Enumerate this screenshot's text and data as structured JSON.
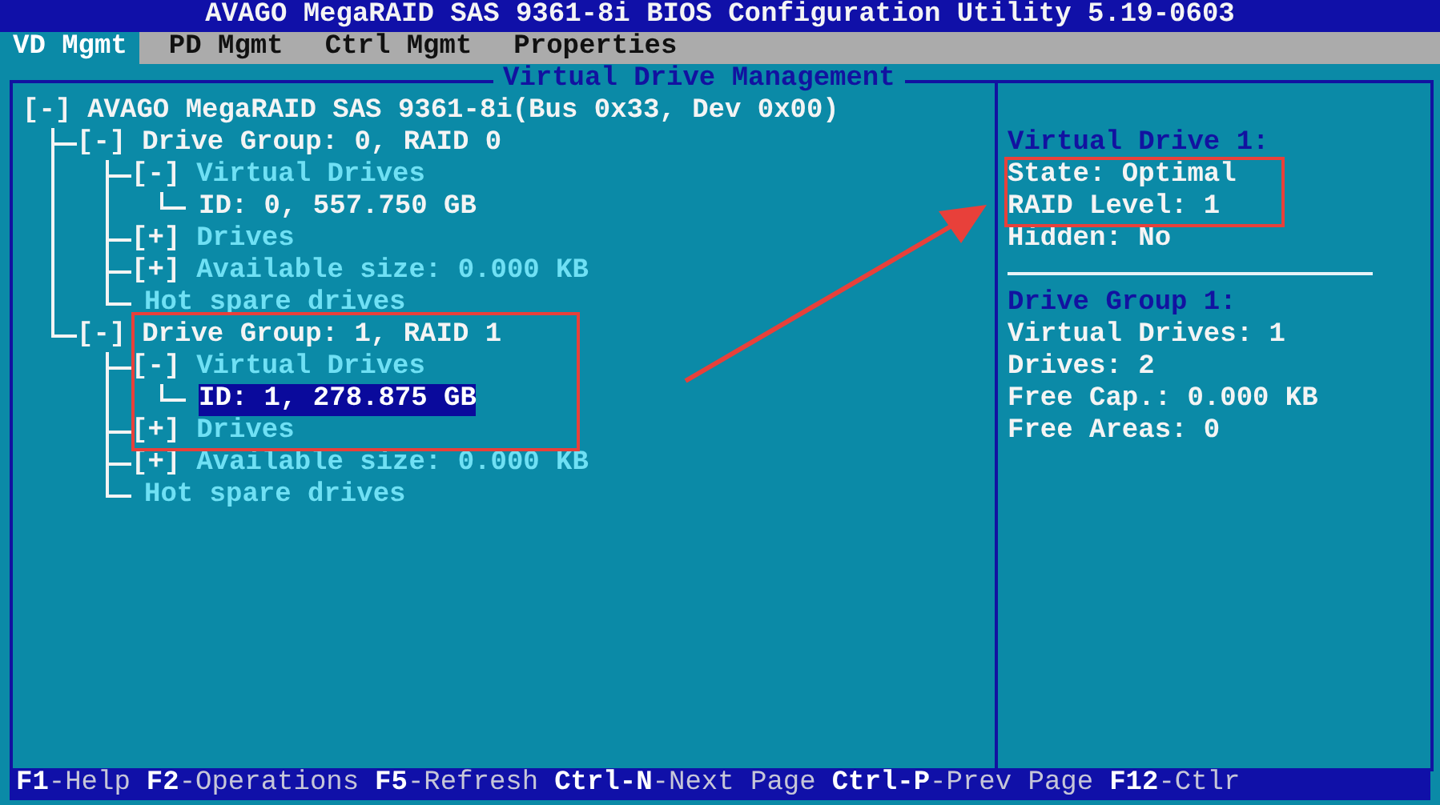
{
  "title_bar": {
    "title": "AVAGO MegaRAID SAS 9361-8i BIOS Configuration Utility 5.19-0603"
  },
  "tabs": [
    {
      "label": "VD Mgmt",
      "selected": true
    },
    {
      "label": "PD Mgmt",
      "selected": false
    },
    {
      "label": "Ctrl Mgmt",
      "selected": false
    },
    {
      "label": "Properties",
      "selected": false
    }
  ],
  "tree_panel": {
    "title": "Virtual Drive Management",
    "tree": [
      {
        "toggle": "[-]",
        "label": "AVAGO MegaRAID SAS 9361-8i(Bus 0x33, Dev 0x00)",
        "kind": "node",
        "selected": false,
        "children": [
          {
            "toggle": "[-]",
            "label": "Drive Group: 0, RAID 0",
            "kind": "node",
            "selected": false,
            "children": [
              {
                "toggle": "[-]",
                "label": "Virtual Drives",
                "kind": "category",
                "selected": false,
                "children": [
                  {
                    "label": "ID: 0, 557.750 GB",
                    "kind": "node",
                    "selected": false
                  }
                ]
              },
              {
                "toggle": "[+]",
                "label": "Drives",
                "kind": "category",
                "selected": false
              },
              {
                "toggle": "[+]",
                "label": "Available size: 0.000 KB",
                "kind": "category",
                "selected": false
              },
              {
                "label": "Hot spare drives",
                "kind": "category",
                "selected": false
              }
            ]
          },
          {
            "toggle": "[-]",
            "label": "Drive Group: 1, RAID 1",
            "kind": "node",
            "selected": false,
            "children": [
              {
                "toggle": "[-]",
                "label": "Virtual Drives",
                "kind": "category",
                "selected": false,
                "children": [
                  {
                    "label": "ID: 1, 278.875 GB",
                    "kind": "node",
                    "selected": true
                  }
                ]
              },
              {
                "toggle": "[+]",
                "label": "Drives",
                "kind": "category",
                "selected": false
              },
              {
                "toggle": "[+]",
                "label": "Available size: 0.000 KB",
                "kind": "category",
                "selected": false
              },
              {
                "label": "Hot spare drives",
                "kind": "category",
                "selected": false
              }
            ]
          }
        ]
      }
    ]
  },
  "info_panel": {
    "sections": [
      {
        "heading": "Virtual Drive 1:",
        "lines": [
          "State: Optimal",
          "RAID Level: 1",
          "Hidden: No"
        ]
      },
      {
        "heading": "Drive Group 1:",
        "lines": [
          "Virtual Drives: 1",
          "Drives: 2",
          "Free Cap.: 0.000 KB",
          "Free Areas: 0"
        ]
      }
    ]
  },
  "status_bar": [
    {
      "key": "F1",
      "label": "-Help"
    },
    {
      "key": "F2",
      "label": "-Operations"
    },
    {
      "key": "F5",
      "label": "-Refresh"
    },
    {
      "key": "Ctrl-N",
      "label": "-Next Page"
    },
    {
      "key": "Ctrl-P",
      "label": "-Prev Page"
    },
    {
      "key": "F12",
      "label": "-Ctlr"
    }
  ]
}
